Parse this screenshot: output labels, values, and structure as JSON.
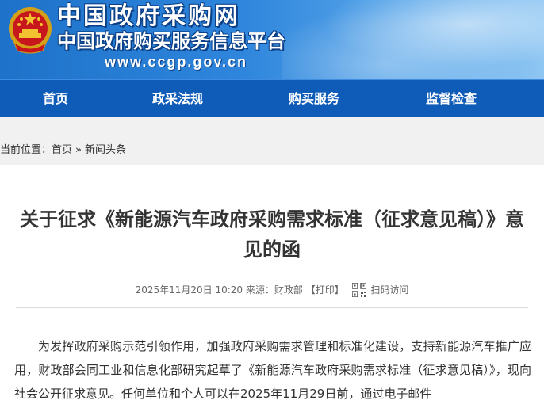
{
  "header": {
    "site_name": "中国政府采购网",
    "site_subtitle": "中国政府购买服务信息平台",
    "site_url": "www.ccgp.gov.cn",
    "emblem_icon": "national-emblem-icon"
  },
  "nav": {
    "items": [
      {
        "label": "首页"
      },
      {
        "label": "政采法规"
      },
      {
        "label": "购买服务"
      },
      {
        "label": "监督检查"
      }
    ]
  },
  "breadcrumb": {
    "prefix": "当前位置：",
    "home": "首页",
    "separator": "»",
    "current": "新闻头条"
  },
  "article": {
    "title": "关于征求《新能源汽车政府采购需求标准（征求意见稿）》意见的函",
    "date": "2025年11月20日 10:20",
    "source_label": "来源：",
    "source": "财政部",
    "print_label": "【打印】",
    "qr_icon": "qr-code-icon",
    "scan_label": "扫码访问",
    "paragraph": "为发挥政府采购示范引领作用，加强政府采购需求管理和标准化建设，支持新能源汽车推广应用，财政部会同工业和信息化部研究起草了《新能源汽车政府采购需求标准（征求意见稿）》，现向社会公开征求意见。任何单位和个人可以在2025年11月29日前，通过电子邮件"
  },
  "colors": {
    "nav_bg": "#0f5bb8",
    "header_bg": "#2f86dc",
    "page_band": "#f1f1f1"
  }
}
